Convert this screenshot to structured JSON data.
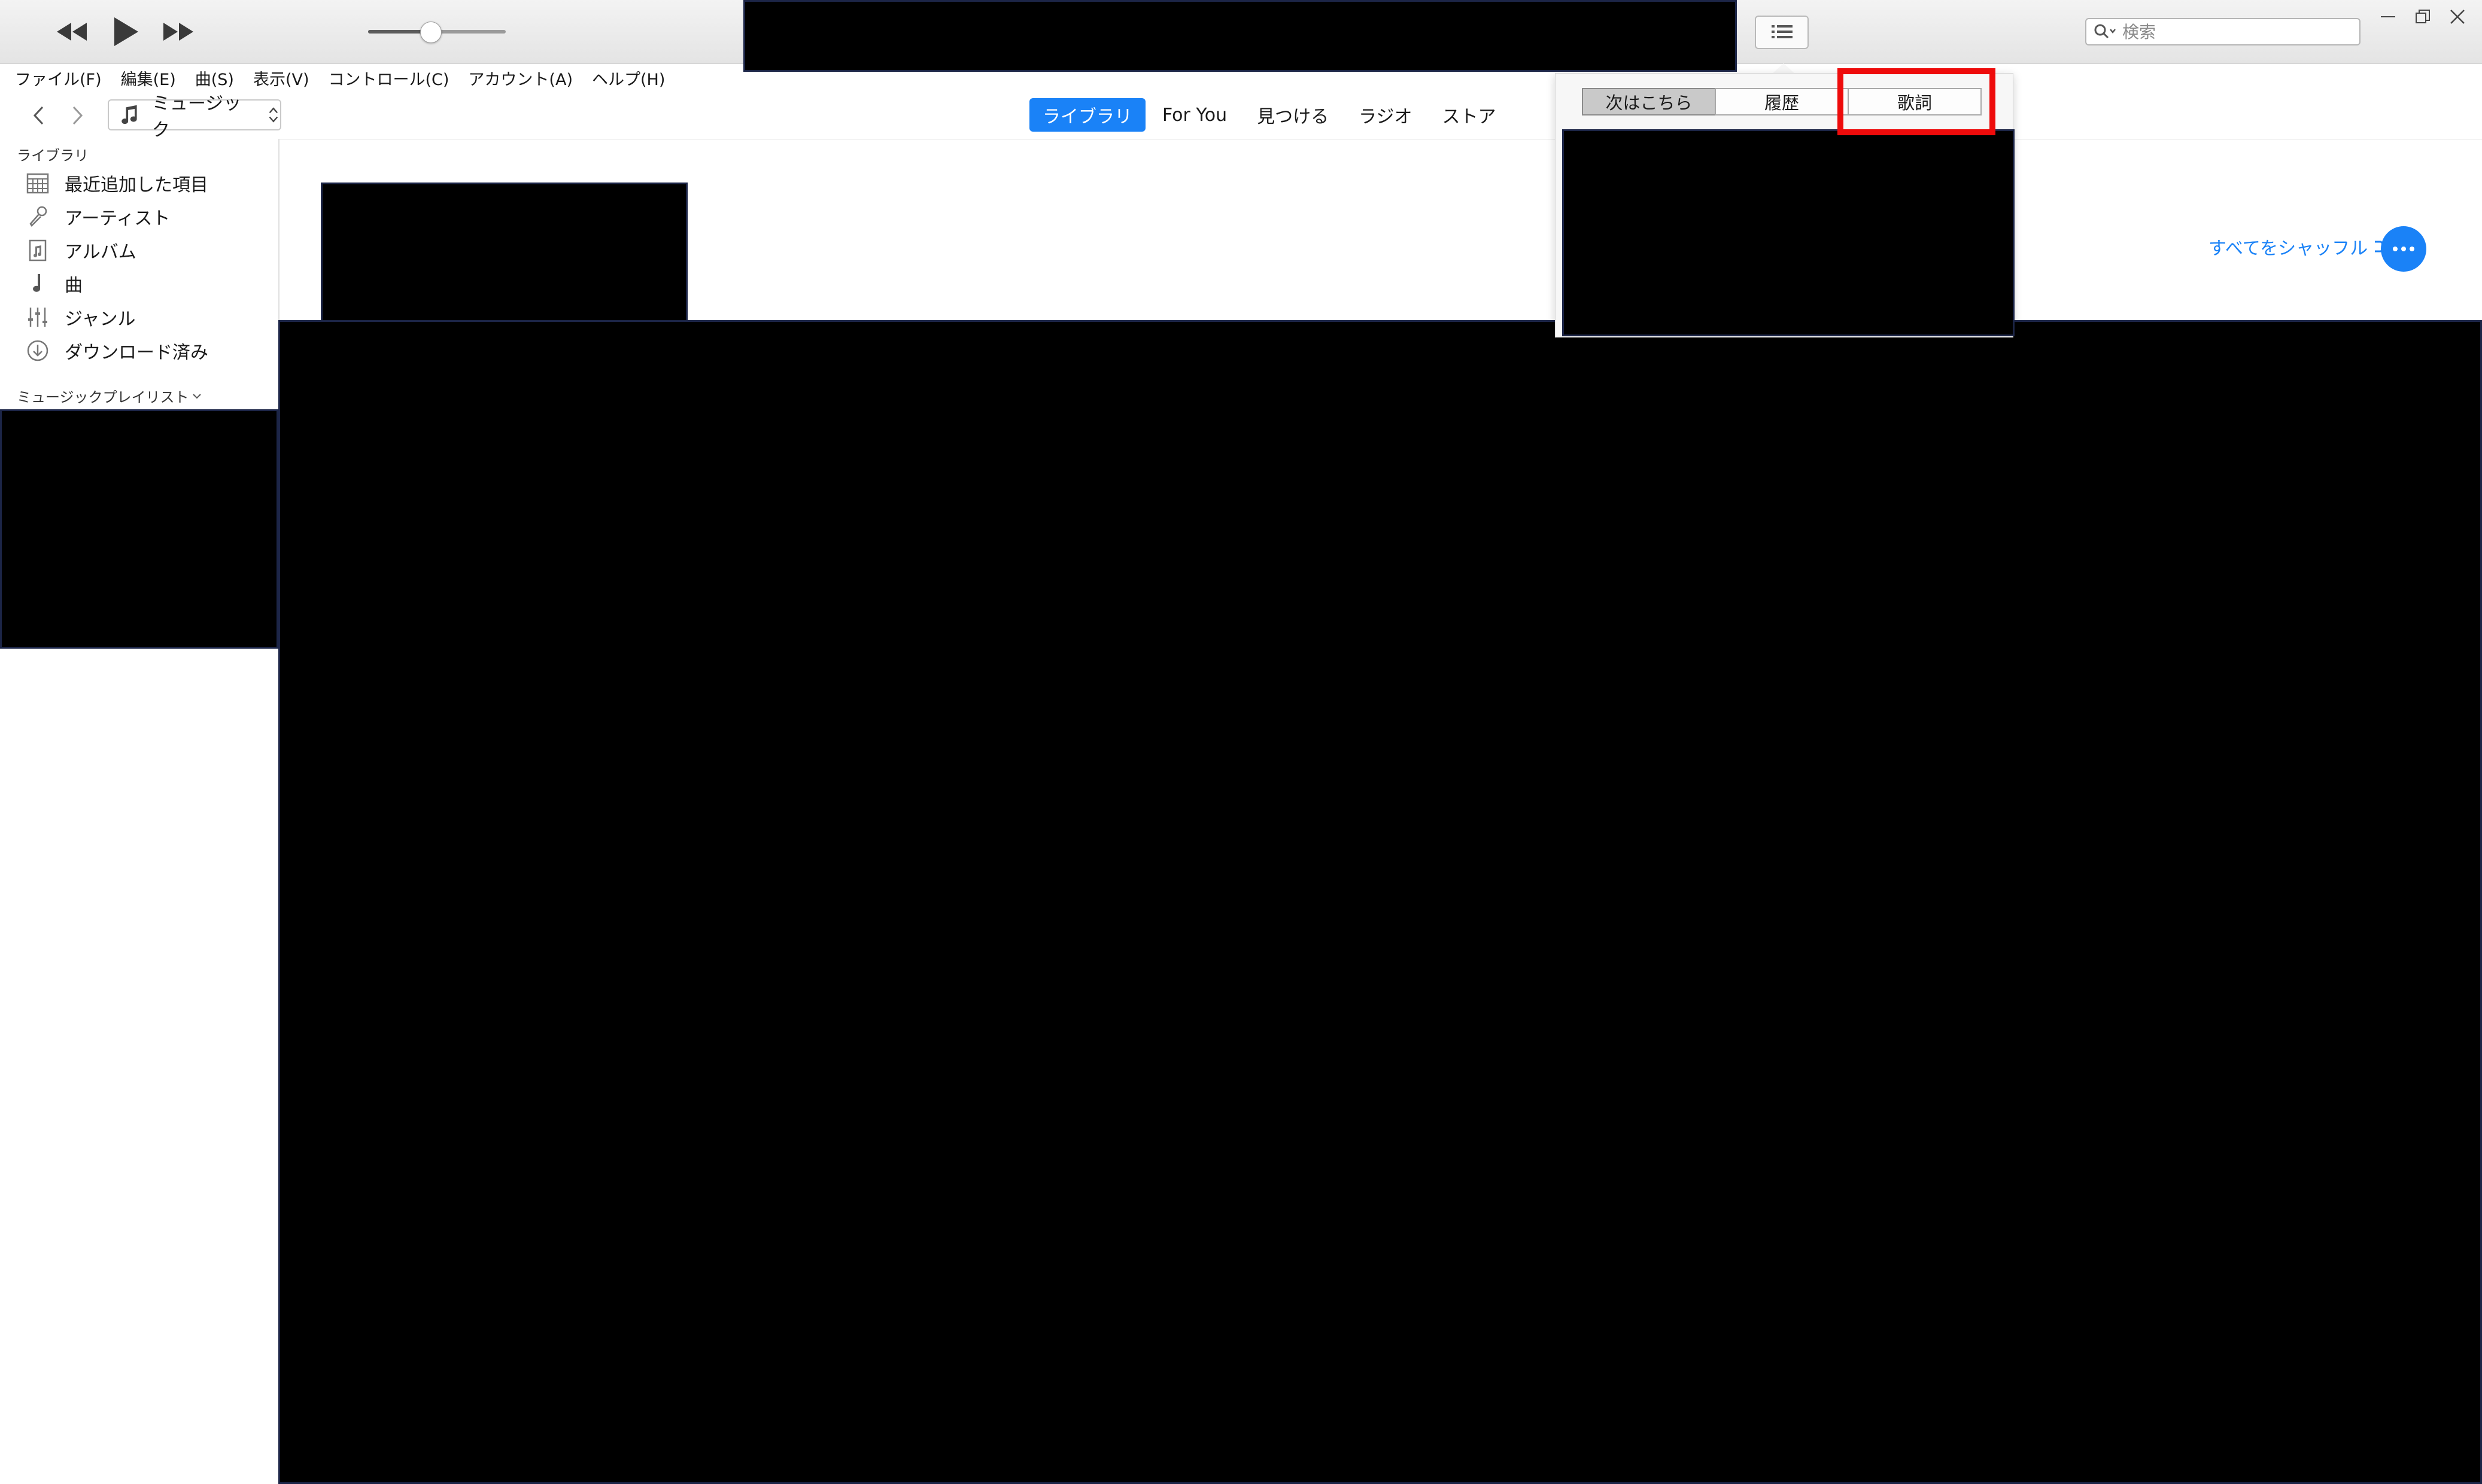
{
  "toolbar": {
    "rewind_icon": "rewind-icon",
    "play_icon": "play-icon",
    "forward_icon": "fast-forward-icon",
    "volume_level": 0.45,
    "queue_icon": "list-icon",
    "search_placeholder": "検索",
    "window_controls": [
      "minimize-icon",
      "restore-icon",
      "close-icon"
    ]
  },
  "menu": {
    "items": [
      "ファイル(F)",
      "編集(E)",
      "曲(S)",
      "表示(V)",
      "コントロール(C)",
      "アカウント(A)",
      "ヘルプ(H)"
    ]
  },
  "nav": {
    "media_type": "ミュージック",
    "tabs": [
      {
        "label": "ライブラリ",
        "active": true
      },
      {
        "label": "For You",
        "active": false
      },
      {
        "label": "見つける",
        "active": false
      },
      {
        "label": "ラジオ",
        "active": false
      },
      {
        "label": "ストア",
        "active": false
      }
    ]
  },
  "sidebar": {
    "library_header": "ライブラリ",
    "items": [
      {
        "label": "最近追加した項目",
        "icon": "recently-added-icon"
      },
      {
        "label": "アーティスト",
        "icon": "microphone-icon"
      },
      {
        "label": "アルバム",
        "icon": "album-icon"
      },
      {
        "label": "曲",
        "icon": "music-note-icon"
      },
      {
        "label": "ジャンル",
        "icon": "genre-icon"
      },
      {
        "label": "ダウンロード済み",
        "icon": "download-icon"
      }
    ],
    "playlists_header": "ミュージックプレイリスト"
  },
  "main": {
    "shuffle_label": "すべてをシャッフル"
  },
  "popover": {
    "tabs": [
      {
        "label": "次はこちら",
        "selected": true
      },
      {
        "label": "履歴",
        "selected": false
      },
      {
        "label": "歌詞",
        "selected": false
      }
    ]
  },
  "colors": {
    "accent": "#1a82f7",
    "highlight": "#ee0b0b"
  }
}
